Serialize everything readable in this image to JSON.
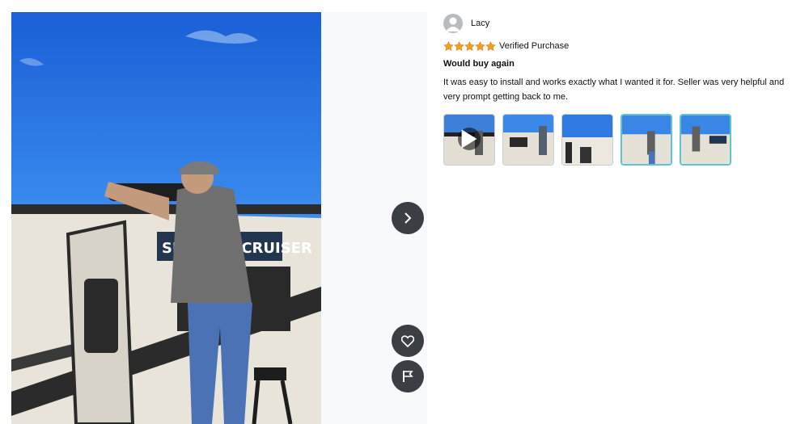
{
  "reviewer": {
    "name": "Lacy",
    "avatar_icon": "person-icon"
  },
  "rating": {
    "stars": 5,
    "max": 5,
    "color": "#f79c1c",
    "verified_label": "Verified Purchase"
  },
  "review": {
    "headline": "Would buy again",
    "body": "It was easy to install and works exactly what I wanted it for. Seller was very helpful and very prompt getting back to me."
  },
  "main_image": {
    "trailer_text": "SHADOW CRUISER"
  },
  "thumbnails": [
    {
      "kind": "video"
    },
    {
      "kind": "photo"
    },
    {
      "kind": "photo"
    },
    {
      "kind": "photo",
      "selected": true
    },
    {
      "kind": "photo",
      "selected": true
    }
  ],
  "controls": {
    "next_icon": "chevron-right-icon",
    "like_icon": "heart-icon",
    "flag_icon": "flag-icon"
  },
  "colors": {
    "button_bg": "#3b3e42",
    "selected_border": "#5fc3d6"
  }
}
